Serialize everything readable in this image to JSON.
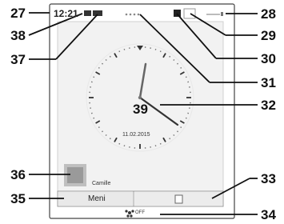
{
  "screen": {
    "status_bar": {
      "time": "12:21",
      "battery_text": "—+"
    },
    "clock": {
      "date": "11.02.2015",
      "center_label": "39"
    },
    "contact": {
      "name": "Camille"
    },
    "bottom_bar": {
      "menu_button": "Meni",
      "right_button_icon": "square-icon"
    },
    "footer": {
      "label": "OFF"
    }
  },
  "callouts": {
    "c27": "27",
    "c38": "38",
    "c37": "37",
    "c36": "36",
    "c35": "35",
    "c28": "28",
    "c29": "29",
    "c30": "30",
    "c31": "31",
    "c32": "32",
    "c33": "33",
    "c34": "34"
  }
}
